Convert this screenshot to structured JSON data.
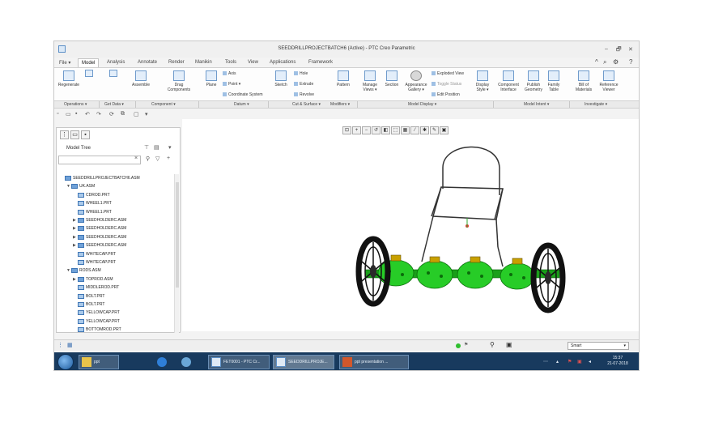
{
  "window": {
    "title": "SEEDDRILLPROJECTBATCH6 (Active) - PTC Creo Parametric",
    "controls": [
      "–",
      "🗗",
      "✕"
    ]
  },
  "tabs": [
    "File ▾",
    "Model",
    "Analysis",
    "Annotate",
    "Render",
    "Manikin",
    "Tools",
    "View",
    "Applications",
    "Framework"
  ],
  "ribbon": {
    "regenerate": "Regenerate",
    "assemble": "Assemble",
    "drag_components": "Drag\nComponents",
    "plane": "Plane",
    "axis": "Axis",
    "point": "Point ▾",
    "coordinate_system": "Coordinate System",
    "sketch": "Sketch",
    "hole": "Hole",
    "extrude": "Extrude",
    "revolve": "Revolve",
    "pattern": "Pattern",
    "manage_views": "Manage\nViews ▾",
    "section": "Section",
    "appearance_gallery": "Appearance\nGallery ▾",
    "exploded_view": "Exploded View",
    "toggle_status": "Toggle Status",
    "edit_position": "Edit Position",
    "display_style": "Display\nStyle ▾",
    "component_interface": "Component\nInterface",
    "publish_geometry": "Publish\nGeometry",
    "family_table": "Family\nTable",
    "bill_of_materials": "Bill of\nMaterials",
    "reference_viewer": "Reference\nViewer"
  },
  "groups": [
    "Operations ▾",
    "Get Data ▾",
    "Component ▾",
    "Datum ▾",
    "Cut & Surface ▾",
    "Modifiers ▾",
    "Model Display ▾",
    "Model Intent ▾",
    "Investigate ▾"
  ],
  "model_tree": {
    "title": "Model Tree",
    "nodes": [
      {
        "label": "SEEDDRILLPROJECTBATCH6.ASM",
        "level": 0,
        "caret": "",
        "kind": "asm"
      },
      {
        "label": "UK.ASM",
        "level": 1,
        "caret": "▼",
        "kind": "asm"
      },
      {
        "label": "CDROD.PRT",
        "level": 2,
        "caret": "",
        "kind": "part"
      },
      {
        "label": "WHEEL1.PRT",
        "level": 2,
        "caret": "",
        "kind": "part"
      },
      {
        "label": "WHEEL1.PRT",
        "level": 2,
        "caret": "",
        "kind": "part"
      },
      {
        "label": "SEEDHOLDERC.ASM",
        "level": 2,
        "caret": "▶",
        "kind": "asm"
      },
      {
        "label": "SEEDHOLDERC.ASM",
        "level": 2,
        "caret": "▶",
        "kind": "asm"
      },
      {
        "label": "SEEDHOLDERC.ASM",
        "level": 2,
        "caret": "▶",
        "kind": "asm"
      },
      {
        "label": "SEEDHOLDERC.ASM",
        "level": 2,
        "caret": "▶",
        "kind": "asm"
      },
      {
        "label": "WHITECAP.PRT",
        "level": 2,
        "caret": "",
        "kind": "part"
      },
      {
        "label": "WHITECAP.PRT",
        "level": 2,
        "caret": "",
        "kind": "part"
      },
      {
        "label": "RODS.ASM",
        "level": 1,
        "caret": "▼",
        "kind": "asm"
      },
      {
        "label": "TOPROD.ASM",
        "level": 2,
        "caret": "▶",
        "kind": "asm"
      },
      {
        "label": "MIDDLEROD.PRT",
        "level": 2,
        "caret": "",
        "kind": "part"
      },
      {
        "label": "BOLT.PRT",
        "level": 2,
        "caret": "",
        "kind": "part"
      },
      {
        "label": "BOLT.PRT",
        "level": 2,
        "caret": "",
        "kind": "part"
      },
      {
        "label": "YELLOWCAP.PRT",
        "level": 2,
        "caret": "",
        "kind": "part"
      },
      {
        "label": "YELLOWCAP.PRT",
        "level": 2,
        "caret": "",
        "kind": "part"
      },
      {
        "label": "BOTTOMROD.PRT",
        "level": 2,
        "caret": "",
        "kind": "part"
      }
    ]
  },
  "status": {
    "filter_value": "Smart"
  },
  "taskbar": {
    "items": [
      "ppt",
      "FET0001 - PTC Cr...",
      "SEEDDRILLPROJE...",
      "ppt presentation ..."
    ],
    "time": "15:37",
    "date": "21-07-2018"
  },
  "colors": {
    "accent": "#1f6fc4",
    "model_green": "#22cc22",
    "wheel_black": "#111111"
  }
}
